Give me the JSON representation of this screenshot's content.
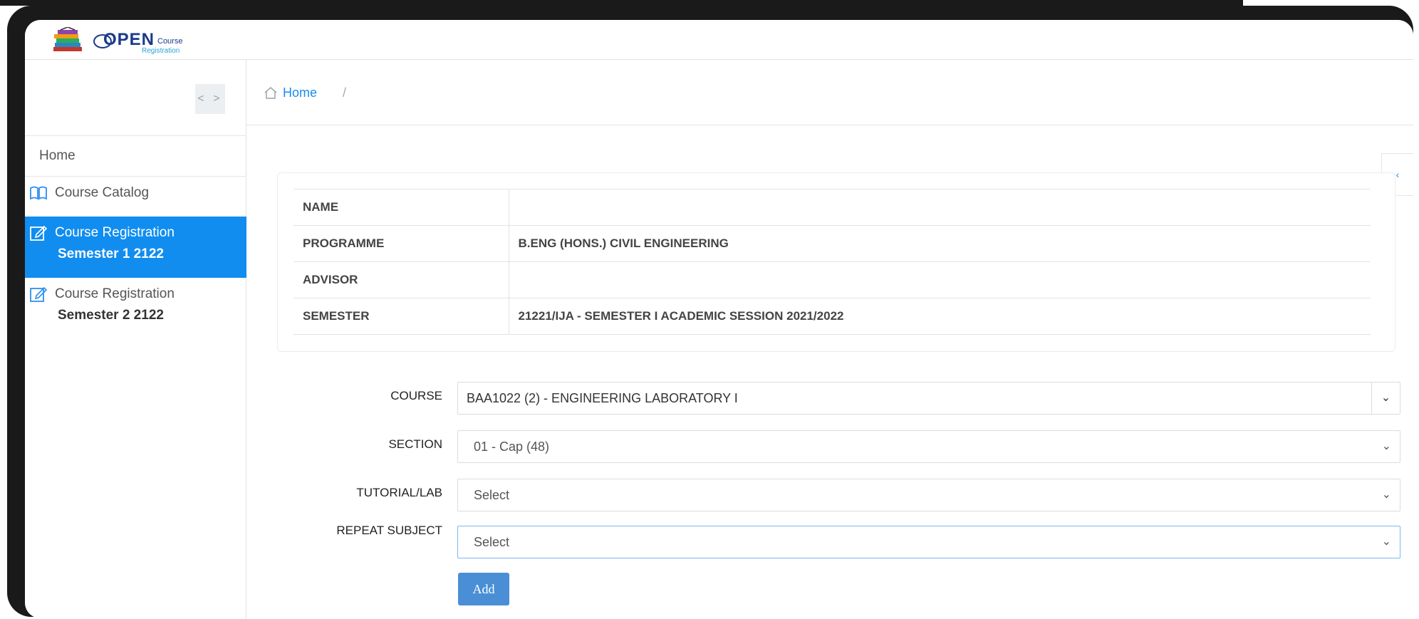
{
  "brand": {
    "open": "OPEN",
    "course": "Course",
    "registration": "Registration"
  },
  "breadcrumb": {
    "home": "Home",
    "separator": "/"
  },
  "sidebar": {
    "toggle": "< >",
    "home": "Home",
    "items": [
      {
        "label": "Course Catalog",
        "sub": "",
        "icon": "book-icon",
        "active": false
      },
      {
        "label": "Course Registration",
        "sub": "Semester 1 2122",
        "icon": "edit-icon",
        "active": true
      },
      {
        "label": "Course Registration",
        "sub": "Semester 2 2122",
        "icon": "edit-icon",
        "active": false
      }
    ]
  },
  "info": {
    "rows": [
      {
        "key": "NAME",
        "value": ""
      },
      {
        "key": "PROGRAMME",
        "value": "B.ENG (HONS.) CIVIL ENGINEERING"
      },
      {
        "key": "ADVISOR",
        "value": ""
      },
      {
        "key": "SEMESTER",
        "value": "21221/IJA - SEMESTER I ACADEMIC SESSION 2021/2022"
      }
    ]
  },
  "form": {
    "course_label": "COURSE",
    "course_value": "BAA1022 (2) - ENGINEERING LABORATORY I",
    "section_label": "SECTION",
    "section_value": "01 - Cap (48)",
    "tutorial_label": "TUTORIAL/LAB",
    "tutorial_value": "Select",
    "repeat_label": "REPEAT SUBJECT",
    "repeat_value": "Select",
    "add_label": "Add"
  },
  "colors": {
    "accent": "#118df0",
    "button": "#4a8fd6",
    "frame": "#1a1a1a"
  }
}
